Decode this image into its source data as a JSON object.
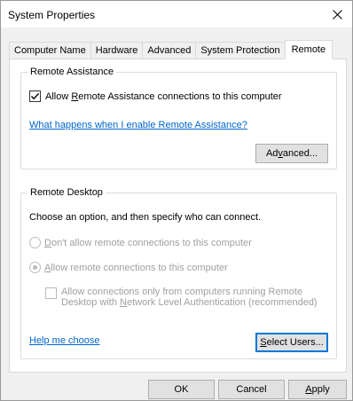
{
  "window": {
    "title": "System Properties"
  },
  "tabs": [
    {
      "label": "Computer Name",
      "active": false
    },
    {
      "label": "Hardware",
      "active": false
    },
    {
      "label": "Advanced",
      "active": false
    },
    {
      "label": "System Protection",
      "active": false
    },
    {
      "label": "Remote",
      "active": true
    }
  ],
  "remote_assistance": {
    "group_title": "Remote Assistance",
    "allow_label_pre": "Allow ",
    "allow_label_key": "R",
    "allow_label_post": "emote Assistance connections to this computer",
    "allow_checked": true,
    "link": "What happens when I enable Remote Assistance?",
    "advanced_pre": "Ad",
    "advanced_key": "v",
    "advanced_post": "anced..."
  },
  "remote_desktop": {
    "group_title": "Remote Desktop",
    "instructions": "Choose an option, and then specify who can connect.",
    "option_dont_key": "D",
    "option_dont_post": "on't allow remote connections to this computer",
    "option_allow_key": "A",
    "option_allow_post": "llow remote connections to this computer",
    "selected_option": "allow",
    "nla_line1": "Allow connections only from computers running Remote",
    "nla_line2_pre": "Desktop with ",
    "nla_line2_key": "N",
    "nla_line2_post": "etwork Level Authentication (recommended)",
    "nla_checked": false,
    "help_link": "Help me choose",
    "select_users_key": "S",
    "select_users_post": "elect Users..."
  },
  "footer": {
    "ok": "OK",
    "cancel": "Cancel",
    "apply_key": "A",
    "apply_post": "pply"
  }
}
